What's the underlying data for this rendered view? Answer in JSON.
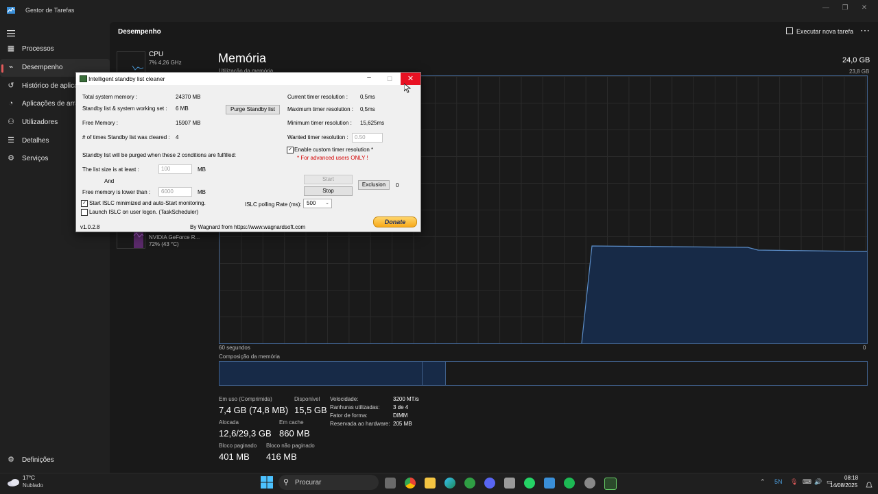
{
  "taskmanager": {
    "title": "Gestor de Tarefas",
    "section": "Desempenho",
    "run_task": "Executar nova tarefa",
    "nav": [
      {
        "label": "Processos",
        "icon": "grid-icon"
      },
      {
        "label": "Desempenho",
        "icon": "pulse-icon",
        "active": true
      },
      {
        "label": "Histórico de aplica",
        "icon": "history-icon"
      },
      {
        "label": "Aplicações de arra",
        "icon": "startup-icon"
      },
      {
        "label": "Utilizadores",
        "icon": "users-icon"
      },
      {
        "label": "Detalhes",
        "icon": "list-icon"
      },
      {
        "label": "Serviços",
        "icon": "gear-icon"
      }
    ],
    "settings_label": "Definições",
    "cpu": {
      "name": "CPU",
      "detail": "7% 4,26 GHz"
    },
    "gpu": {
      "name": "NVIDIA GeForce R...",
      "detail": "72% (43 °C)"
    },
    "memory": {
      "title": "Memória",
      "subtitle": "Utilização da memória",
      "total": "24,0 GB",
      "max": "23,8 GB",
      "graph_left": "60 segundos",
      "graph_right": "0",
      "composition_label": "Composição da memória",
      "usage_fraction": 0.31,
      "stats": {
        "in_use_label": "Em uso (Comprimida)",
        "in_use": "7,4 GB (74,8 MB)",
        "available_label": "Disponível",
        "available": "15,5 GB",
        "committed_label": "Alocada",
        "committed": "12,6/29,3 GB",
        "cached_label": "Em cache",
        "cached": "860 MB",
        "paged_label": "Bloco paginado",
        "paged": "401 MB",
        "nonpaged_label": "Bloco não paginado",
        "nonpaged": "416 MB"
      },
      "details": [
        {
          "label": "Velocidade:",
          "value": "3200 MT/s"
        },
        {
          "label": "Ranhuras utilizadas:",
          "value": "3 de 4"
        },
        {
          "label": "Fator de forma:",
          "value": "DIMM"
        },
        {
          "label": "Reservada ao hardware:",
          "value": "205 MB"
        }
      ]
    }
  },
  "islc": {
    "title": "Intelligent standby list cleaner",
    "total_mem_label": "Total system memory :",
    "total_mem": "24370 MB",
    "standby_label": "Standby list & system working set :",
    "standby": "6 MB",
    "free_label": "Free Memory :",
    "free": "15907 MB",
    "cleared_label": "# of times Standby list was cleared :",
    "cleared": "4",
    "purge_btn": "Purge Standby list",
    "current_res_label": "Current timer resolution :",
    "current_res": "0,5ms",
    "max_res_label": "Maximum timer resolution :",
    "max_res": "0,5ms",
    "min_res_label": "Minimum timer resolution :",
    "min_res": "15,625ms",
    "wanted_res_label": "Wanted timer resolution :",
    "wanted_res": "0.50",
    "custom_res_label": "Enable custom timer resolution *",
    "advanced_note": "* For advanced users ONLY !",
    "conditions_text": "Standby list will be purged when these 2 conditions are fulfilled:",
    "list_size_label": "The list size is at least :",
    "list_size": "100",
    "mb1": "MB",
    "and_label": "And",
    "free_lower_label": "Free memory is lower than :",
    "free_lower": "6000",
    "mb2": "MB",
    "start_btn": "Start",
    "stop_btn": "Stop",
    "exclusion_btn": "Exclusion",
    "exclusion_count": "0",
    "autostart_label": "Start ISLC minimized and auto-Start monitoring.",
    "logon_label": "Launch ISLC on user logon. (TaskScheduler)",
    "polling_label": "ISLC polling Rate (ms):",
    "polling": "500",
    "version": "v1.0.2.8",
    "credit": "By Wagnard from https://www.wagnardsoft.com",
    "donate": "Donate",
    "check": "✓"
  },
  "taskbar": {
    "weather_temp": "17°C",
    "weather_desc": "Nublado",
    "search_placeholder": "Procurar",
    "time": "08:18",
    "date": "14/08/2025"
  }
}
